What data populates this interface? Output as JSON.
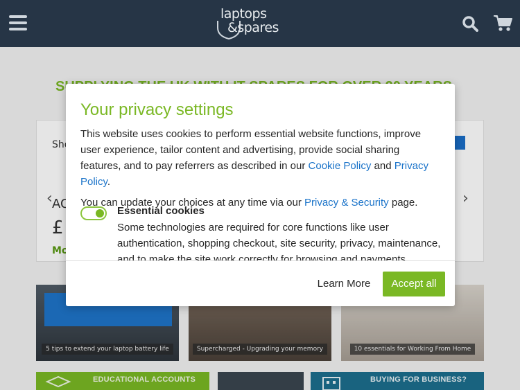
{
  "header": {
    "logo_line1": "laptops",
    "logo_line2": "&spares"
  },
  "page": {
    "banner": "SUPPLYING THE UK WITH IT SPARES FOR OVER 20 YEARS",
    "product": {
      "text1": "Sho",
      "text2": "AC",
      "price": "£",
      "more": "Mo"
    },
    "tiles": [
      {
        "caption": "5 tips to extend your laptop battery life"
      },
      {
        "caption": "Supercharged - Upgrading your memory"
      },
      {
        "caption": "10 essentials for Working From Home"
      }
    ],
    "strips": [
      {
        "label": "EDUCATIONAL ACCOUNTS"
      },
      {
        "label": "BUYING FOR BUSINESS?"
      }
    ]
  },
  "modal": {
    "title": "Your privacy settings",
    "para1_a": "This website uses cookies to perform essential website functions, improve user experience, tailor content and advertising, provide social sharing features, and to pay referrers as described in our ",
    "cookie_policy_link": "Cookie Policy",
    "para1_and": " and ",
    "privacy_policy_link": "Privacy Policy",
    "para1_end": ".",
    "para2_a": "You can update your choices at any time via our ",
    "privacy_security_link": "Privacy & Security",
    "para2_end": " page.",
    "essential_title": "Essential cookies",
    "essential_desc": "Some technologies are required for core functions like user authentication, shopping checkout, site security, privacy, maintenance, and to make the site work correctly for browsing and payments.",
    "essential_toggle_on": true,
    "learn_more": "Learn More",
    "accept_all": "Accept all"
  },
  "colors": {
    "header_bg": "#263546",
    "brand_green": "#7ab824",
    "link_blue": "#1a73c9"
  }
}
